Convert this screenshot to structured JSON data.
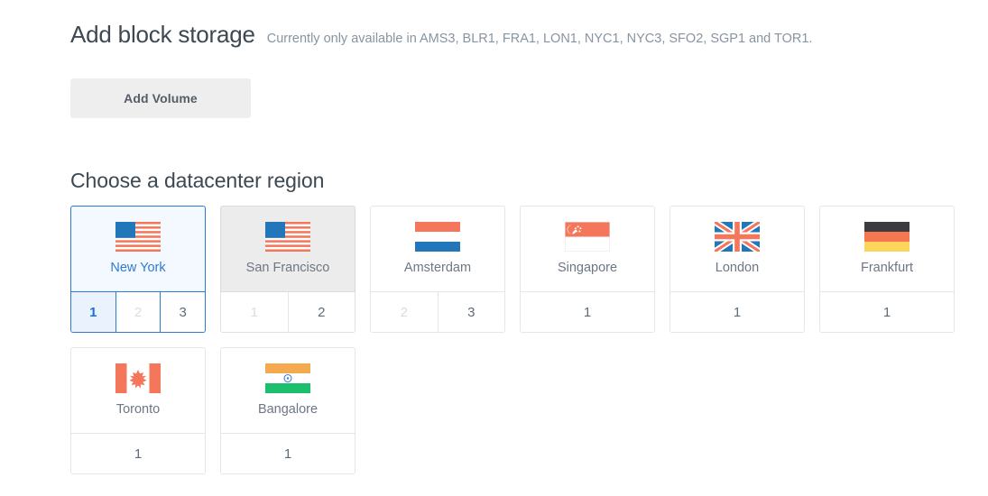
{
  "header": {
    "title": "Add block storage",
    "subtitle": "Currently only available in AMS3, BLR1, FRA1, LON1, NYC1, NYC3, SFO2, SGP1 and TOR1."
  },
  "actions": {
    "add_volume_label": "Add Volume"
  },
  "region_section": {
    "title": "Choose a datacenter region",
    "regions": [
      {
        "name": "New York",
        "flag": "flag-us",
        "state": "selected",
        "slots": [
          {
            "label": "1",
            "state": "active"
          },
          {
            "label": "2",
            "state": "disabled"
          },
          {
            "label": "3",
            "state": "available"
          }
        ]
      },
      {
        "name": "San Francisco",
        "flag": "flag-us",
        "state": "hovered",
        "slots": [
          {
            "label": "1",
            "state": "disabled"
          },
          {
            "label": "2",
            "state": "available"
          }
        ]
      },
      {
        "name": "Amsterdam",
        "flag": "flag-nl",
        "state": "default",
        "slots": [
          {
            "label": "2",
            "state": "disabled"
          },
          {
            "label": "3",
            "state": "available"
          }
        ]
      },
      {
        "name": "Singapore",
        "flag": "flag-sg",
        "state": "default",
        "slots": [
          {
            "label": "1",
            "state": "available"
          }
        ]
      },
      {
        "name": "London",
        "flag": "flag-gb",
        "state": "default",
        "slots": [
          {
            "label": "1",
            "state": "available"
          }
        ]
      },
      {
        "name": "Frankfurt",
        "flag": "flag-de",
        "state": "default",
        "slots": [
          {
            "label": "1",
            "state": "available"
          }
        ]
      },
      {
        "name": "Toronto",
        "flag": "flag-ca",
        "state": "default",
        "slots": [
          {
            "label": "1",
            "state": "available"
          }
        ]
      },
      {
        "name": "Bangalore",
        "flag": "flag-in",
        "state": "default",
        "slots": [
          {
            "label": "1",
            "state": "available"
          }
        ]
      }
    ]
  },
  "colors": {
    "accent_blue": "#2e7ad1",
    "flag_red": "#f4775c",
    "flag_blue": "#2277bb",
    "text_dark": "#3d4852",
    "text_muted": "#8794a1",
    "border": "#e4e6e8",
    "button_bg": "#eeeeee"
  }
}
